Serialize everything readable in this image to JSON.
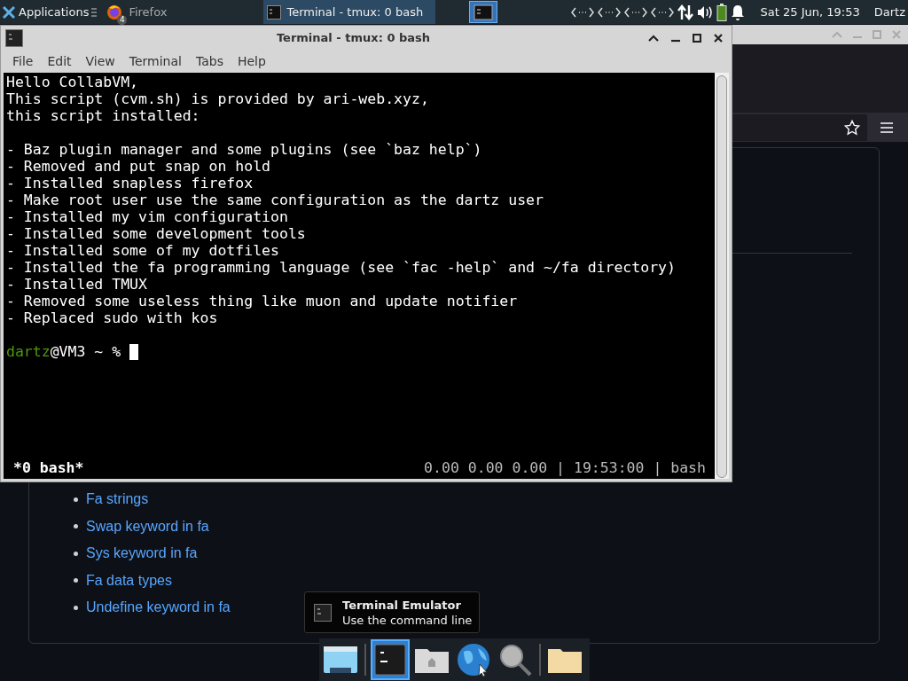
{
  "top_panel": {
    "menu_label": "Applications",
    "tasks": [
      {
        "label": "Firefox",
        "badge": "4",
        "selected": false
      },
      {
        "label": "Terminal - tmux: 0 bash",
        "selected": true
      }
    ],
    "clock": "Sat 25 Jun, 19:53",
    "user": "Dartz"
  },
  "browser": {
    "links": [
      "Fa strings",
      "Swap keyword in fa",
      "Sys keyword in fa",
      "Fa data types",
      "Undefine keyword in fa"
    ]
  },
  "terminal": {
    "title": "Terminal - tmux: 0 bash",
    "menu": [
      "File",
      "Edit",
      "View",
      "Terminal",
      "Tabs",
      "Help"
    ],
    "intro": [
      "Hello CollabVM,",
      "This script (cvm.sh) is provided by ari-web.xyz,",
      "this script installed:"
    ],
    "installed": [
      "- Baz plugin manager and some plugins (see `baz help`)",
      "- Removed and put snap on hold",
      "- Installed snapless firefox",
      "- Make root user use the same configuration as the dartz user",
      "- Installed my vim configuration",
      "- Installed some development tools",
      "- Installed some of my dotfiles",
      "- Installed the fa programming language (see `fac -help` and ~/fa directory)",
      "- Installed TMUX",
      "- Removed some useless thing like muon and update notifier",
      "- Replaced sudo with kos"
    ],
    "prompt_user": "dartz",
    "prompt_rest": "@VM3 ~ %",
    "status_window": "*0 bash*",
    "status_right": "0.00 0.00 0.00 | 19:53:00 | bash"
  },
  "tooltip": {
    "title": "Terminal Emulator",
    "subtitle": "Use the command line"
  },
  "dock": [
    {
      "kind": "desktop",
      "selected": false
    },
    {
      "kind": "separator"
    },
    {
      "kind": "terminal",
      "selected": true
    },
    {
      "kind": "home",
      "selected": false
    },
    {
      "kind": "browser",
      "selected": false
    },
    {
      "kind": "search",
      "selected": false
    },
    {
      "kind": "separator"
    },
    {
      "kind": "folder",
      "selected": false
    }
  ]
}
